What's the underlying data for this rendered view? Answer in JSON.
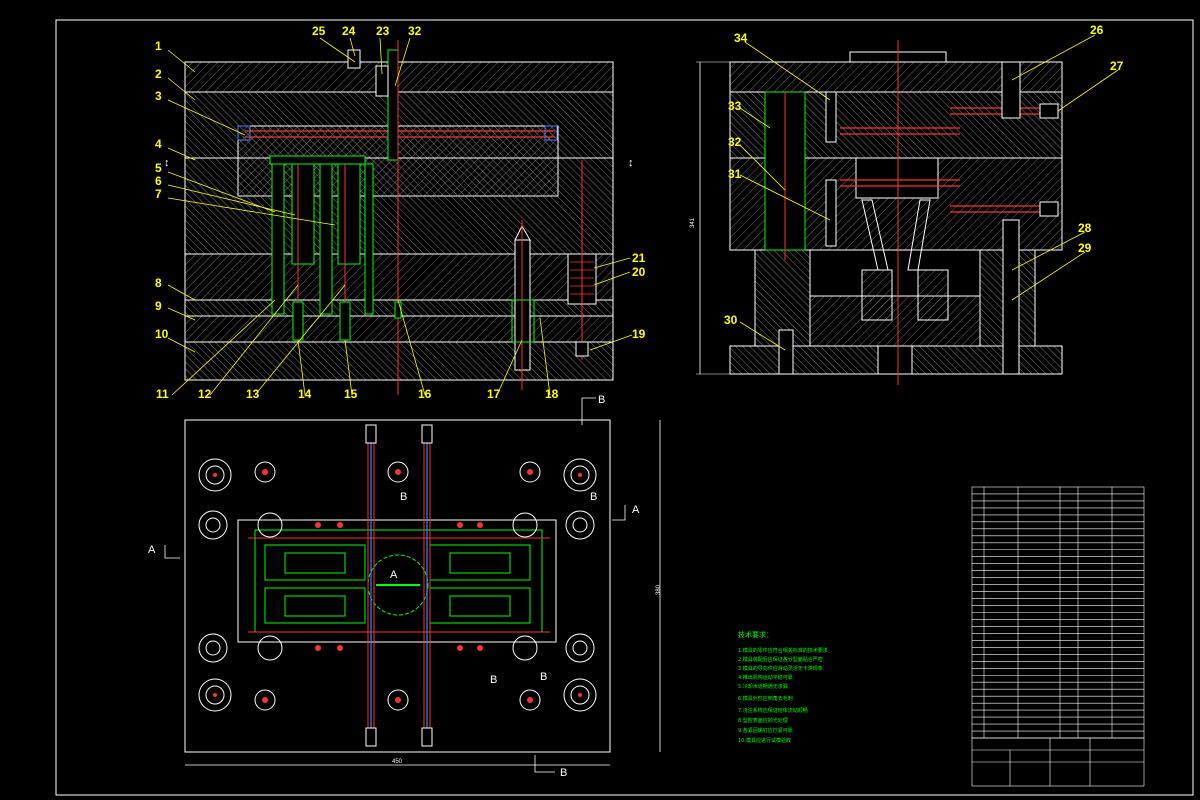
{
  "part_labels_left": [
    "1",
    "2",
    "3",
    "4",
    "5",
    "6",
    "7",
    "8",
    "9",
    "10",
    "11",
    "12",
    "13",
    "14",
    "15",
    "16",
    "17",
    "18",
    "19",
    "20",
    "21",
    "23",
    "24",
    "25",
    "32"
  ],
  "part_labels_right": [
    "26",
    "27",
    "28",
    "29",
    "30",
    "31",
    "32",
    "33",
    "34"
  ],
  "section_labels": {
    "a": "A",
    "b": "B"
  },
  "dimensions": {
    "overall_width": "450",
    "side_height": "341",
    "plate_height": "380"
  },
  "tech_title": "技术要求：",
  "tech_lines": [
    "1.模具的零件应符合相关标准的技术要求",
    "2.模具装配后应保证各分型面贴合严密",
    "3.模具的导向件应滑动灵活无卡滞现象",
    "4.推出机构运动平稳可靠",
    "5.冷却水道畅通无渗漏",
    "6.模具外形应倒角去毛刺",
    "7.浇注系统应保证熔体流动顺畅",
    "8.型腔表面应抛光处理",
    "9.各紧固螺钉应拧紧可靠",
    "10.模具应进行试模验收"
  ]
}
